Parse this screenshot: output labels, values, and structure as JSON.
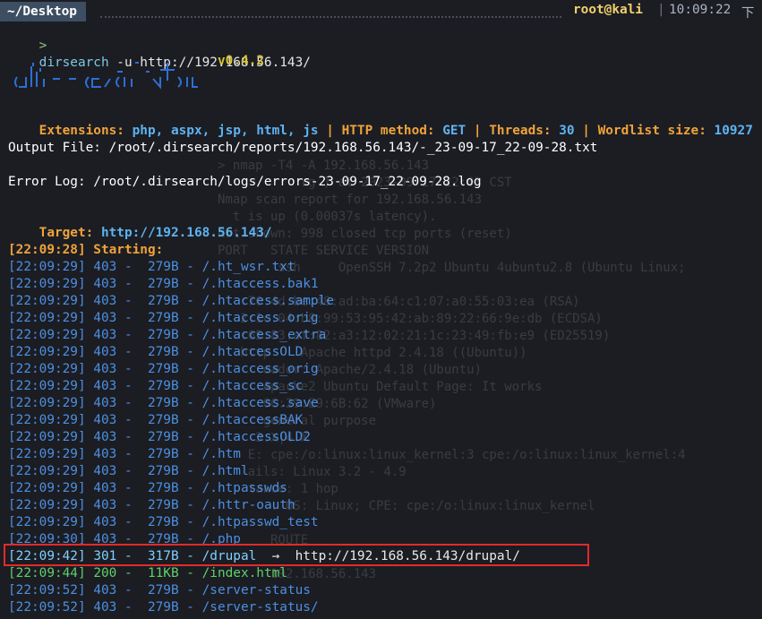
{
  "header": {
    "tab": "~/Desktop",
    "user": "root@kali",
    "separator": "|",
    "time": "10:09:22",
    "trailing": "下"
  },
  "command": {
    "prompt": ">",
    "name": "dirsearch",
    "args": " -u http://192.168.56.143/"
  },
  "banner": {
    "version": "v0.4.2"
  },
  "config": {
    "ext_label": "Extensions:",
    "ext_value": "php, aspx, jsp, html, js",
    "method_label": "HTTP method:",
    "method_value": "GET",
    "threads_label": "Threads:",
    "threads_value": "30",
    "wordlist_label": "Wordlist size:",
    "wordlist_value": "10927",
    "pipe": "|"
  },
  "output_file": "Output File: /root/.dirsearch/reports/192.168.56.143/-_23-09-17_22-09-28.txt",
  "error_log": "Error Log: /root/.dirsearch/logs/errors-23-09-17_22-09-28.log",
  "target": {
    "label": "Target:",
    "url": "http://192.168.56.143/"
  },
  "starting": "[22:09:28] Starting:",
  "results": [
    {
      "t": "[22:09:29]",
      "code": "403",
      "size": " 279B",
      "path": "/.ht_wsr.txt",
      "color": "blue"
    },
    {
      "t": "[22:09:29]",
      "code": "403",
      "size": " 279B",
      "path": "/.htaccess.bak1",
      "color": "blue"
    },
    {
      "t": "[22:09:29]",
      "code": "403",
      "size": " 279B",
      "path": "/.htaccess.sample",
      "color": "blue"
    },
    {
      "t": "[22:09:29]",
      "code": "403",
      "size": " 279B",
      "path": "/.htaccess.orig",
      "color": "blue"
    },
    {
      "t": "[22:09:29]",
      "code": "403",
      "size": " 279B",
      "path": "/.htaccess_extra",
      "color": "blue"
    },
    {
      "t": "[22:09:29]",
      "code": "403",
      "size": " 279B",
      "path": "/.htaccessOLD",
      "color": "blue"
    },
    {
      "t": "[22:09:29]",
      "code": "403",
      "size": " 279B",
      "path": "/.htaccess_orig",
      "color": "blue"
    },
    {
      "t": "[22:09:29]",
      "code": "403",
      "size": " 279B",
      "path": "/.htaccess_sc",
      "color": "blue"
    },
    {
      "t": "[22:09:29]",
      "code": "403",
      "size": " 279B",
      "path": "/.htaccess.save",
      "color": "blue"
    },
    {
      "t": "[22:09:29]",
      "code": "403",
      "size": " 279B",
      "path": "/.htaccessBAK",
      "color": "blue"
    },
    {
      "t": "[22:09:29]",
      "code": "403",
      "size": " 279B",
      "path": "/.htaccessOLD2",
      "color": "blue"
    },
    {
      "t": "[22:09:29]",
      "code": "403",
      "size": " 279B",
      "path": "/.htm",
      "color": "blue"
    },
    {
      "t": "[22:09:29]",
      "code": "403",
      "size": " 279B",
      "path": "/.html",
      "color": "blue"
    },
    {
      "t": "[22:09:29]",
      "code": "403",
      "size": " 279B",
      "path": "/.htpasswds",
      "color": "blue"
    },
    {
      "t": "[22:09:29]",
      "code": "403",
      "size": " 279B",
      "path": "/.httr-oauth",
      "color": "blue"
    },
    {
      "t": "[22:09:29]",
      "code": "403",
      "size": " 279B",
      "path": "/.htpasswd_test",
      "color": "blue"
    },
    {
      "t": "[22:09:30]",
      "code": "403",
      "size": " 279B",
      "path": "/.php",
      "color": "blue"
    },
    {
      "t": "[22:09:42]",
      "code": "301",
      "size": " 317B",
      "path": "/drupal",
      "redirect": "http://192.168.56.143/drupal/",
      "color": "cyan"
    },
    {
      "t": "[22:09:44]",
      "code": "200",
      "size": " 11KB",
      "path": "/index.html",
      "color": "green"
    },
    {
      "t": "[22:09:52]",
      "code": "403",
      "size": " 279B",
      "path": "/server-status",
      "color": "blue"
    },
    {
      "t": "[22:09:52]",
      "code": "403",
      "size": " 279B",
      "path": "/server-status/",
      "color": "blue"
    }
  ],
  "arrow": "→",
  "dash": "-",
  "ghost_lines": [
    "> nmap -T4 -A 192.168.56.143",
    "           rg ) at 2023-09-17 22:03 CST",
    "Nmap scan report for 192.168.56.143",
    "  t is up (0.00037s latency).",
    "Not shown: 998 closed tcp ports (reset)",
    "PORT   STATE SERVICE VERSION",
    "        ssh     OpenSSH 7.2p2 Ubuntu 4ubuntu2.8 (Ubuntu Linux;",
    "",
    "   :70:4d:be:48:ad:ba:64:c1:07:a0:55:03:ea (RSA)",
    "   2:1c:04:b8:99:53:95:42:ab:89:22:66:9e:db (ECDSA)",
    "   :65:83:af:82:a3:12:02:21:1c:23:49:fb:e9 (ED25519)",
    "   http    Apache httpd 2.4.18 ((Ubuntu))",
    "      eader: Apache/2.4.18 (Ubuntu)",
    "      Apache2 Ubuntu Default Page: It works",
    "      0C:29:E9:6B:62 (VMware)",
    "      general purpose",
    "     3.X|4.X",
    "    E: cpe:/o:linux:linux_kernel:3 cpe:/o:linux:linux_kernel:4",
    "    ails: Linux 3.2 - 4.9",
    "    tance: 1 hop",
    "       : OS: Linux; CPE: cpe:/o:linux:linux_kernel",
    "",
    "       ROUTE",
    "",
    "       192.168.56.143"
  ]
}
